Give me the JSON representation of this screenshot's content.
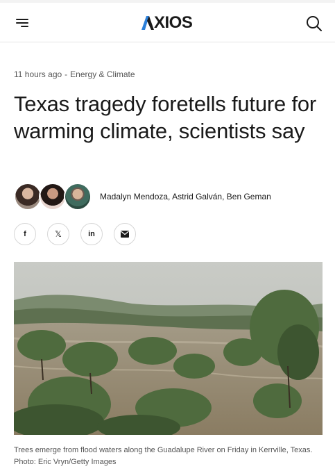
{
  "header": {
    "logo_text": "XIOS",
    "menu_icon": "hamburger-menu-icon",
    "search_icon": "search-icon"
  },
  "article": {
    "time": "11 hours ago",
    "separator": "-",
    "section": "Energy & Climate",
    "title": "Texas tragedy foretells future for warming climate, scientists say",
    "authors": "Madalyn Mendoza, Astrid Galván, Ben Geman"
  },
  "share": {
    "facebook": "f",
    "x": "𝕏",
    "linkedin": "in",
    "email_icon": "mail-icon"
  },
  "photo": {
    "caption": "Trees emerge from flood waters along the Guadalupe River on Friday in Kerrville, Texas. Photo: Eric Vryn/Getty Images"
  }
}
